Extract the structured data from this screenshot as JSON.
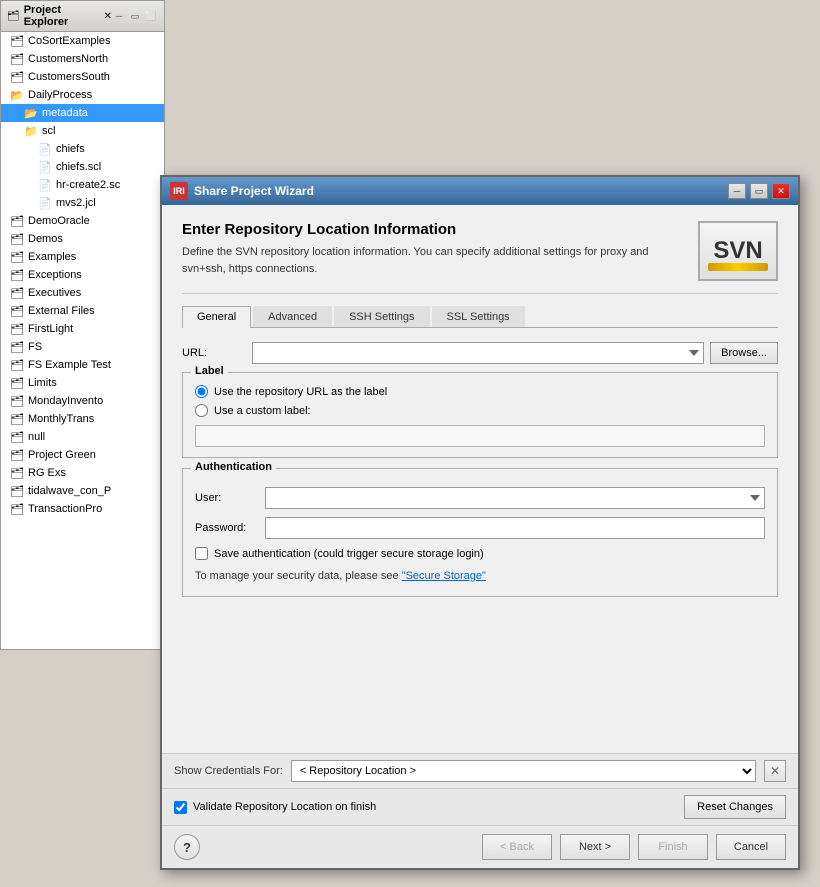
{
  "projectExplorer": {
    "title": "Project Explorer",
    "items": [
      {
        "label": "CoSortExamples",
        "type": "project",
        "indent": 0
      },
      {
        "label": "CustomersNorth",
        "type": "project",
        "indent": 0
      },
      {
        "label": "CustomersSouth",
        "type": "project",
        "indent": 0
      },
      {
        "label": "DailyProcess",
        "type": "project-open",
        "indent": 0
      },
      {
        "label": "metadata",
        "type": "folder-open",
        "indent": 1,
        "selected": true
      },
      {
        "label": "scl",
        "type": "folder",
        "indent": 1
      },
      {
        "label": "chiefs",
        "type": "file",
        "indent": 2
      },
      {
        "label": "chiefs.scl",
        "type": "file",
        "indent": 2
      },
      {
        "label": "hr-create2.sc",
        "type": "file",
        "indent": 2
      },
      {
        "label": "mvs2.jcl",
        "type": "file",
        "indent": 2
      },
      {
        "label": "DemoOracle",
        "type": "project",
        "indent": 0
      },
      {
        "label": "Demos",
        "type": "project",
        "indent": 0
      },
      {
        "label": "Examples",
        "type": "project",
        "indent": 0
      },
      {
        "label": "Exceptions",
        "type": "project",
        "indent": 0
      },
      {
        "label": "Executives",
        "type": "project",
        "indent": 0
      },
      {
        "label": "External Files",
        "type": "project",
        "indent": 0
      },
      {
        "label": "FirstLight",
        "type": "project",
        "indent": 0
      },
      {
        "label": "FS",
        "type": "project",
        "indent": 0
      },
      {
        "label": "FS Example Test",
        "type": "project",
        "indent": 0
      },
      {
        "label": "Limits",
        "type": "project",
        "indent": 0
      },
      {
        "label": "MondayInvento",
        "type": "project",
        "indent": 0
      },
      {
        "label": "MonthlyTrans",
        "type": "project",
        "indent": 0
      },
      {
        "label": "null",
        "type": "project",
        "indent": 0
      },
      {
        "label": "Project Green",
        "type": "project",
        "indent": 0
      },
      {
        "label": "RG Exs",
        "type": "project",
        "indent": 0
      },
      {
        "label": "tidalwave_con_P",
        "type": "project",
        "indent": 0
      },
      {
        "label": "TransactionPro",
        "type": "project",
        "indent": 0
      }
    ]
  },
  "dialog": {
    "title": "Share Project Wizard",
    "logo": "IRI",
    "svnLogo": "SVN",
    "wizardTitle": "Enter Repository Location Information",
    "wizardDescription": "Define the SVN repository location information. You can specify additional settings for proxy and svn+ssh, https connections.",
    "tabs": [
      {
        "label": "General",
        "active": true
      },
      {
        "label": "Advanced",
        "active": false
      },
      {
        "label": "SSH Settings",
        "active": false
      },
      {
        "label": "SSL Settings",
        "active": false
      }
    ],
    "urlLabel": "URL:",
    "urlPlaceholder": "",
    "browseBtnLabel": "Browse...",
    "labelGroup": "Label",
    "labelOptions": [
      {
        "label": "Use the repository URL as the label",
        "selected": true
      },
      {
        "label": "Use a custom label:",
        "selected": false
      }
    ],
    "customLabelPlaceholder": "",
    "authGroup": "Authentication",
    "userLabel": "User:",
    "passwordLabel": "Password:",
    "saveAuthLabel": "Save authentication (could trigger secure storage login)",
    "secureStorageText": "To manage your security data, please see ",
    "secureStorageLink": "\"Secure Storage\"",
    "credentialsLabel": "Show Credentials For:",
    "credentialsPlaceholder": "< Repository Location >",
    "validateLabel": "Validate Repository Location on finish",
    "resetBtnLabel": "Reset Changes",
    "helpBtn": "?",
    "backBtn": "< Back",
    "nextBtn": "Next >",
    "finishBtn": "Finish",
    "cancelBtn": "Cancel"
  }
}
